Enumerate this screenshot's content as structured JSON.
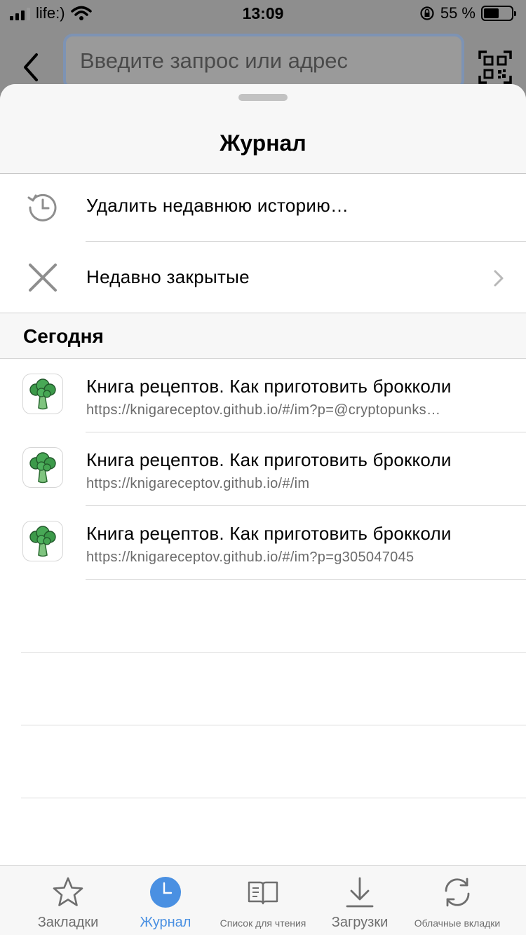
{
  "status_bar": {
    "carrier": "life:)",
    "time": "13:09",
    "battery_percent": "55 %",
    "battery_level": 0.55
  },
  "browser": {
    "search_placeholder": "Введите запрос или адрес"
  },
  "sheet": {
    "title": "Журнал",
    "actions": [
      {
        "label": "Удалить недавнюю историю…",
        "icon": "clock-history-icon"
      },
      {
        "label": "Недавно закрытые",
        "icon": "close-x-icon"
      }
    ],
    "section_title": "Сегодня",
    "history": [
      {
        "title": "Книга рецептов. Как приготовить брокколи",
        "url": "https://knigareceptov.github.io/#/im?p=@cryptopunks…",
        "icon": "broccoli-icon"
      },
      {
        "title": "Книга рецептов. Как приготовить брокколи",
        "url": "https://knigareceptov.github.io/#/im",
        "icon": "broccoli-icon"
      },
      {
        "title": "Книга рецептов. Как приготовить брокколи",
        "url": "https://knigareceptov.github.io/#/im?p=g305047045",
        "icon": "broccoli-icon"
      }
    ]
  },
  "tab_bar": {
    "tabs": [
      {
        "label": "Закладки",
        "icon": "star-icon"
      },
      {
        "label": "Журнал",
        "icon": "clock-icon",
        "active": true
      },
      {
        "label": "Список для чтения",
        "icon": "book-icon"
      },
      {
        "label": "Загрузки",
        "icon": "download-icon"
      },
      {
        "label": "Облачные вкладки",
        "icon": "sync-icon"
      }
    ]
  },
  "colors": {
    "accent": "#4a90e2",
    "icon_gray": "#8e8e8e",
    "broccoli_green": "#3c9a4a"
  }
}
